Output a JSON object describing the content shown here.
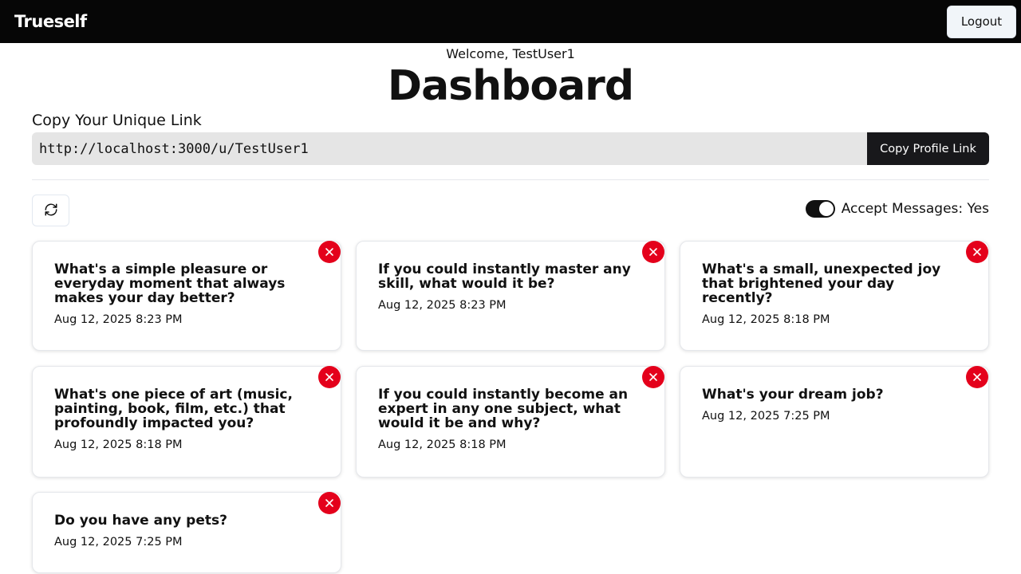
{
  "app": {
    "brand": "Trueself",
    "logout_label": "Logout"
  },
  "header": {
    "welcome": "Welcome, TestUser1",
    "title": "Dashboard"
  },
  "link_section": {
    "heading": "Copy Your Unique Link",
    "url": "http://localhost:3000/u/TestUser1",
    "copy_label": "Copy Profile Link"
  },
  "controls": {
    "refresh_icon": "refresh-icon",
    "accept_label": "Accept Messages: Yes",
    "accept_enabled": true
  },
  "messages": [
    {
      "text": "What's a simple pleasure or everyday moment that always makes your day better?",
      "date": "Aug 12, 2025 8:23 PM"
    },
    {
      "text": "If you could instantly master any skill, what would it be?",
      "date": "Aug 12, 2025 8:23 PM"
    },
    {
      "text": "What's a small, unexpected joy that brightened your day recently?",
      "date": "Aug 12, 2025 8:18 PM"
    },
    {
      "text": "What's one piece of art (music, painting, book, film, etc.) that profoundly impacted you?",
      "date": "Aug 12, 2025 8:18 PM"
    },
    {
      "text": "If you could instantly become an expert in any one subject, what would it be and why?",
      "date": "Aug 12, 2025 8:18 PM"
    },
    {
      "text": "What's your dream job?",
      "date": "Aug 12, 2025 7:25 PM"
    },
    {
      "text": "Do you have any pets?",
      "date": "Aug 12, 2025 7:25 PM"
    }
  ],
  "colors": {
    "navbar": "#060606",
    "delete": "#e4001b",
    "toggle_on": "#111111",
    "url_field": "#e5e5e5"
  }
}
